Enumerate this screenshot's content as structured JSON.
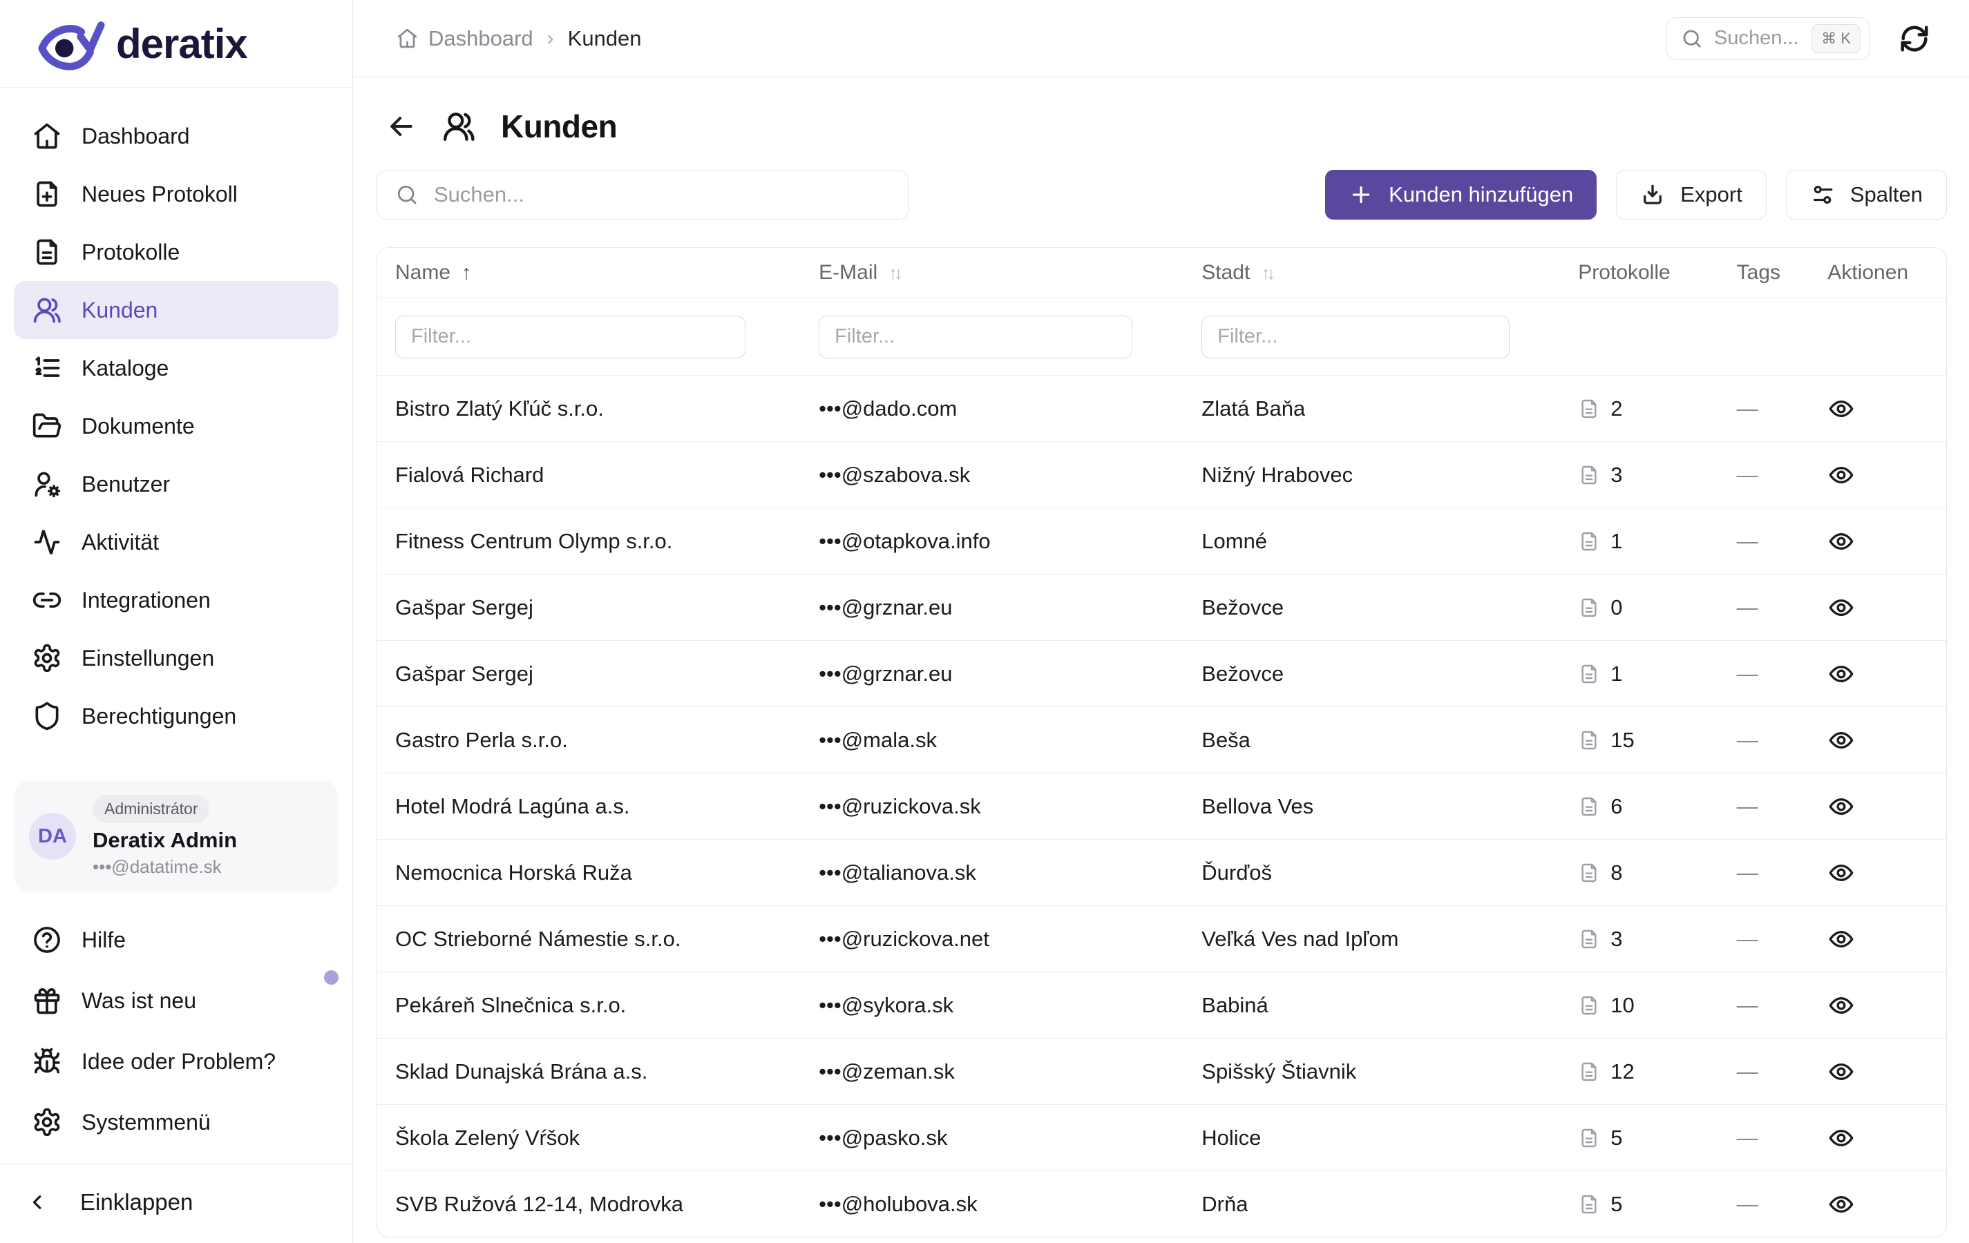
{
  "brand": {
    "name": "deratix"
  },
  "colors": {
    "primary_button": "#5a479e",
    "sidebar_active_bg": "#edeaf7",
    "sidebar_active_text": "#5a49bd",
    "logo_purple": "#5851c6",
    "logo_dark": "#1b1740",
    "notification_dot": "#a9a1d9"
  },
  "topbar": {
    "breadcrumb": [
      {
        "label": "Dashboard",
        "icon": "home-icon"
      },
      {
        "label": "Kunden"
      }
    ],
    "search": {
      "placeholder": "Suchen...",
      "shortcut": "⌘ K",
      "icon": "search-icon"
    },
    "refresh_icon": "refresh-icon"
  },
  "sidebar": {
    "items": [
      {
        "label": "Dashboard",
        "icon": "home-icon",
        "active": false
      },
      {
        "label": "Neues Protokoll",
        "icon": "file-plus-icon",
        "active": false
      },
      {
        "label": "Protokolle",
        "icon": "file-text-icon",
        "active": false
      },
      {
        "label": "Kunden",
        "icon": "users-icon",
        "active": true
      },
      {
        "label": "Kataloge",
        "icon": "list-ordered-icon",
        "active": false
      },
      {
        "label": "Dokumente",
        "icon": "folder-open-icon",
        "active": false
      },
      {
        "label": "Benutzer",
        "icon": "user-gear-icon",
        "active": false
      },
      {
        "label": "Aktivität",
        "icon": "activity-icon",
        "active": false
      },
      {
        "label": "Integrationen",
        "icon": "link-icon",
        "active": false
      },
      {
        "label": "Einstellungen",
        "icon": "gear-icon",
        "active": false
      },
      {
        "label": "Berechtigungen",
        "icon": "shield-icon",
        "active": false
      }
    ],
    "user": {
      "initials": "DA",
      "role_badge": "Administrátor",
      "name": "Deratix Admin",
      "email": "•••@datatime.sk"
    },
    "footer_items": [
      {
        "label": "Hilfe",
        "icon": "help-circle-icon",
        "notification_dot": false
      },
      {
        "label": "Was ist neu",
        "icon": "gift-icon",
        "notification_dot": true
      },
      {
        "label": "Idee oder Problem?",
        "icon": "bug-icon",
        "notification_dot": false
      },
      {
        "label": "Systemmenü",
        "icon": "gear-icon",
        "notification_dot": false
      }
    ],
    "collapse": {
      "label": "Einklappen",
      "icon": "chevron-left-icon"
    }
  },
  "page": {
    "title": "Kunden",
    "title_icon": "users-icon",
    "back_icon": "arrow-left-icon",
    "search_placeholder": "Suchen...",
    "actions": [
      {
        "label": "Kunden hinzufügen",
        "icon": "plus-icon",
        "variant": "primary"
      },
      {
        "label": "Export",
        "icon": "download-icon",
        "variant": "secondary"
      },
      {
        "label": "Spalten",
        "icon": "columns-settings-icon",
        "variant": "secondary"
      }
    ]
  },
  "table": {
    "columns": [
      {
        "label": "Name",
        "sort": "asc",
        "filterable": true
      },
      {
        "label": "E-Mail",
        "sort": "none",
        "filterable": true
      },
      {
        "label": "Stadt",
        "sort": "none",
        "filterable": true
      },
      {
        "label": "Protokolle",
        "filterable": false
      },
      {
        "label": "Tags",
        "filterable": false
      },
      {
        "label": "Aktionen",
        "filterable": false
      }
    ],
    "filter_placeholder": "Filter...",
    "protocols_icon": "file-text-icon",
    "action_icon": "eye-icon",
    "rows": [
      {
        "name": "Bistro Zlatý Kľúč s.r.o.",
        "email": "•••@dado.com",
        "city": "Zlatá Baňa",
        "protocols": 2,
        "tags": "—"
      },
      {
        "name": "Fialová Richard",
        "email": "•••@szabova.sk",
        "city": "Nižný Hrabovec",
        "protocols": 3,
        "tags": "—"
      },
      {
        "name": "Fitness Centrum Olymp s.r.o.",
        "email": "•••@otapkova.info",
        "city": "Lomné",
        "protocols": 1,
        "tags": "—"
      },
      {
        "name": "Gašpar Sergej",
        "email": "•••@grznar.eu",
        "city": "Bežovce",
        "protocols": 0,
        "tags": "—"
      },
      {
        "name": "Gašpar Sergej",
        "email": "•••@grznar.eu",
        "city": "Bežovce",
        "protocols": 1,
        "tags": "—"
      },
      {
        "name": "Gastro Perla s.r.o.",
        "email": "•••@mala.sk",
        "city": "Beša",
        "protocols": 15,
        "tags": "—"
      },
      {
        "name": "Hotel Modrá Lagúna a.s.",
        "email": "•••@ruzickova.sk",
        "city": "Bellova Ves",
        "protocols": 6,
        "tags": "—"
      },
      {
        "name": "Nemocnica Horská Ruža",
        "email": "•••@talianova.sk",
        "city": "Ďurďoš",
        "protocols": 8,
        "tags": "—"
      },
      {
        "name": "OC Strieborné Námestie s.r.o.",
        "email": "•••@ruzickova.net",
        "city": "Veľká Ves nad Ipľom",
        "protocols": 3,
        "tags": "—"
      },
      {
        "name": "Pekáreň Slnečnica s.r.o.",
        "email": "•••@sykora.sk",
        "city": "Babiná",
        "protocols": 10,
        "tags": "—"
      },
      {
        "name": "Sklad Dunajská Brána a.s.",
        "email": "•••@zeman.sk",
        "city": "Spišský Štiavnik",
        "protocols": 12,
        "tags": "—"
      },
      {
        "name": "Škola Zelený Vŕšok",
        "email": "•••@pasko.sk",
        "city": "Holice",
        "protocols": 5,
        "tags": "—"
      },
      {
        "name": "SVB Ružová 12-14, Modrovka",
        "email": "•••@holubova.sk",
        "city": "Drňa",
        "protocols": 5,
        "tags": "—"
      }
    ]
  }
}
